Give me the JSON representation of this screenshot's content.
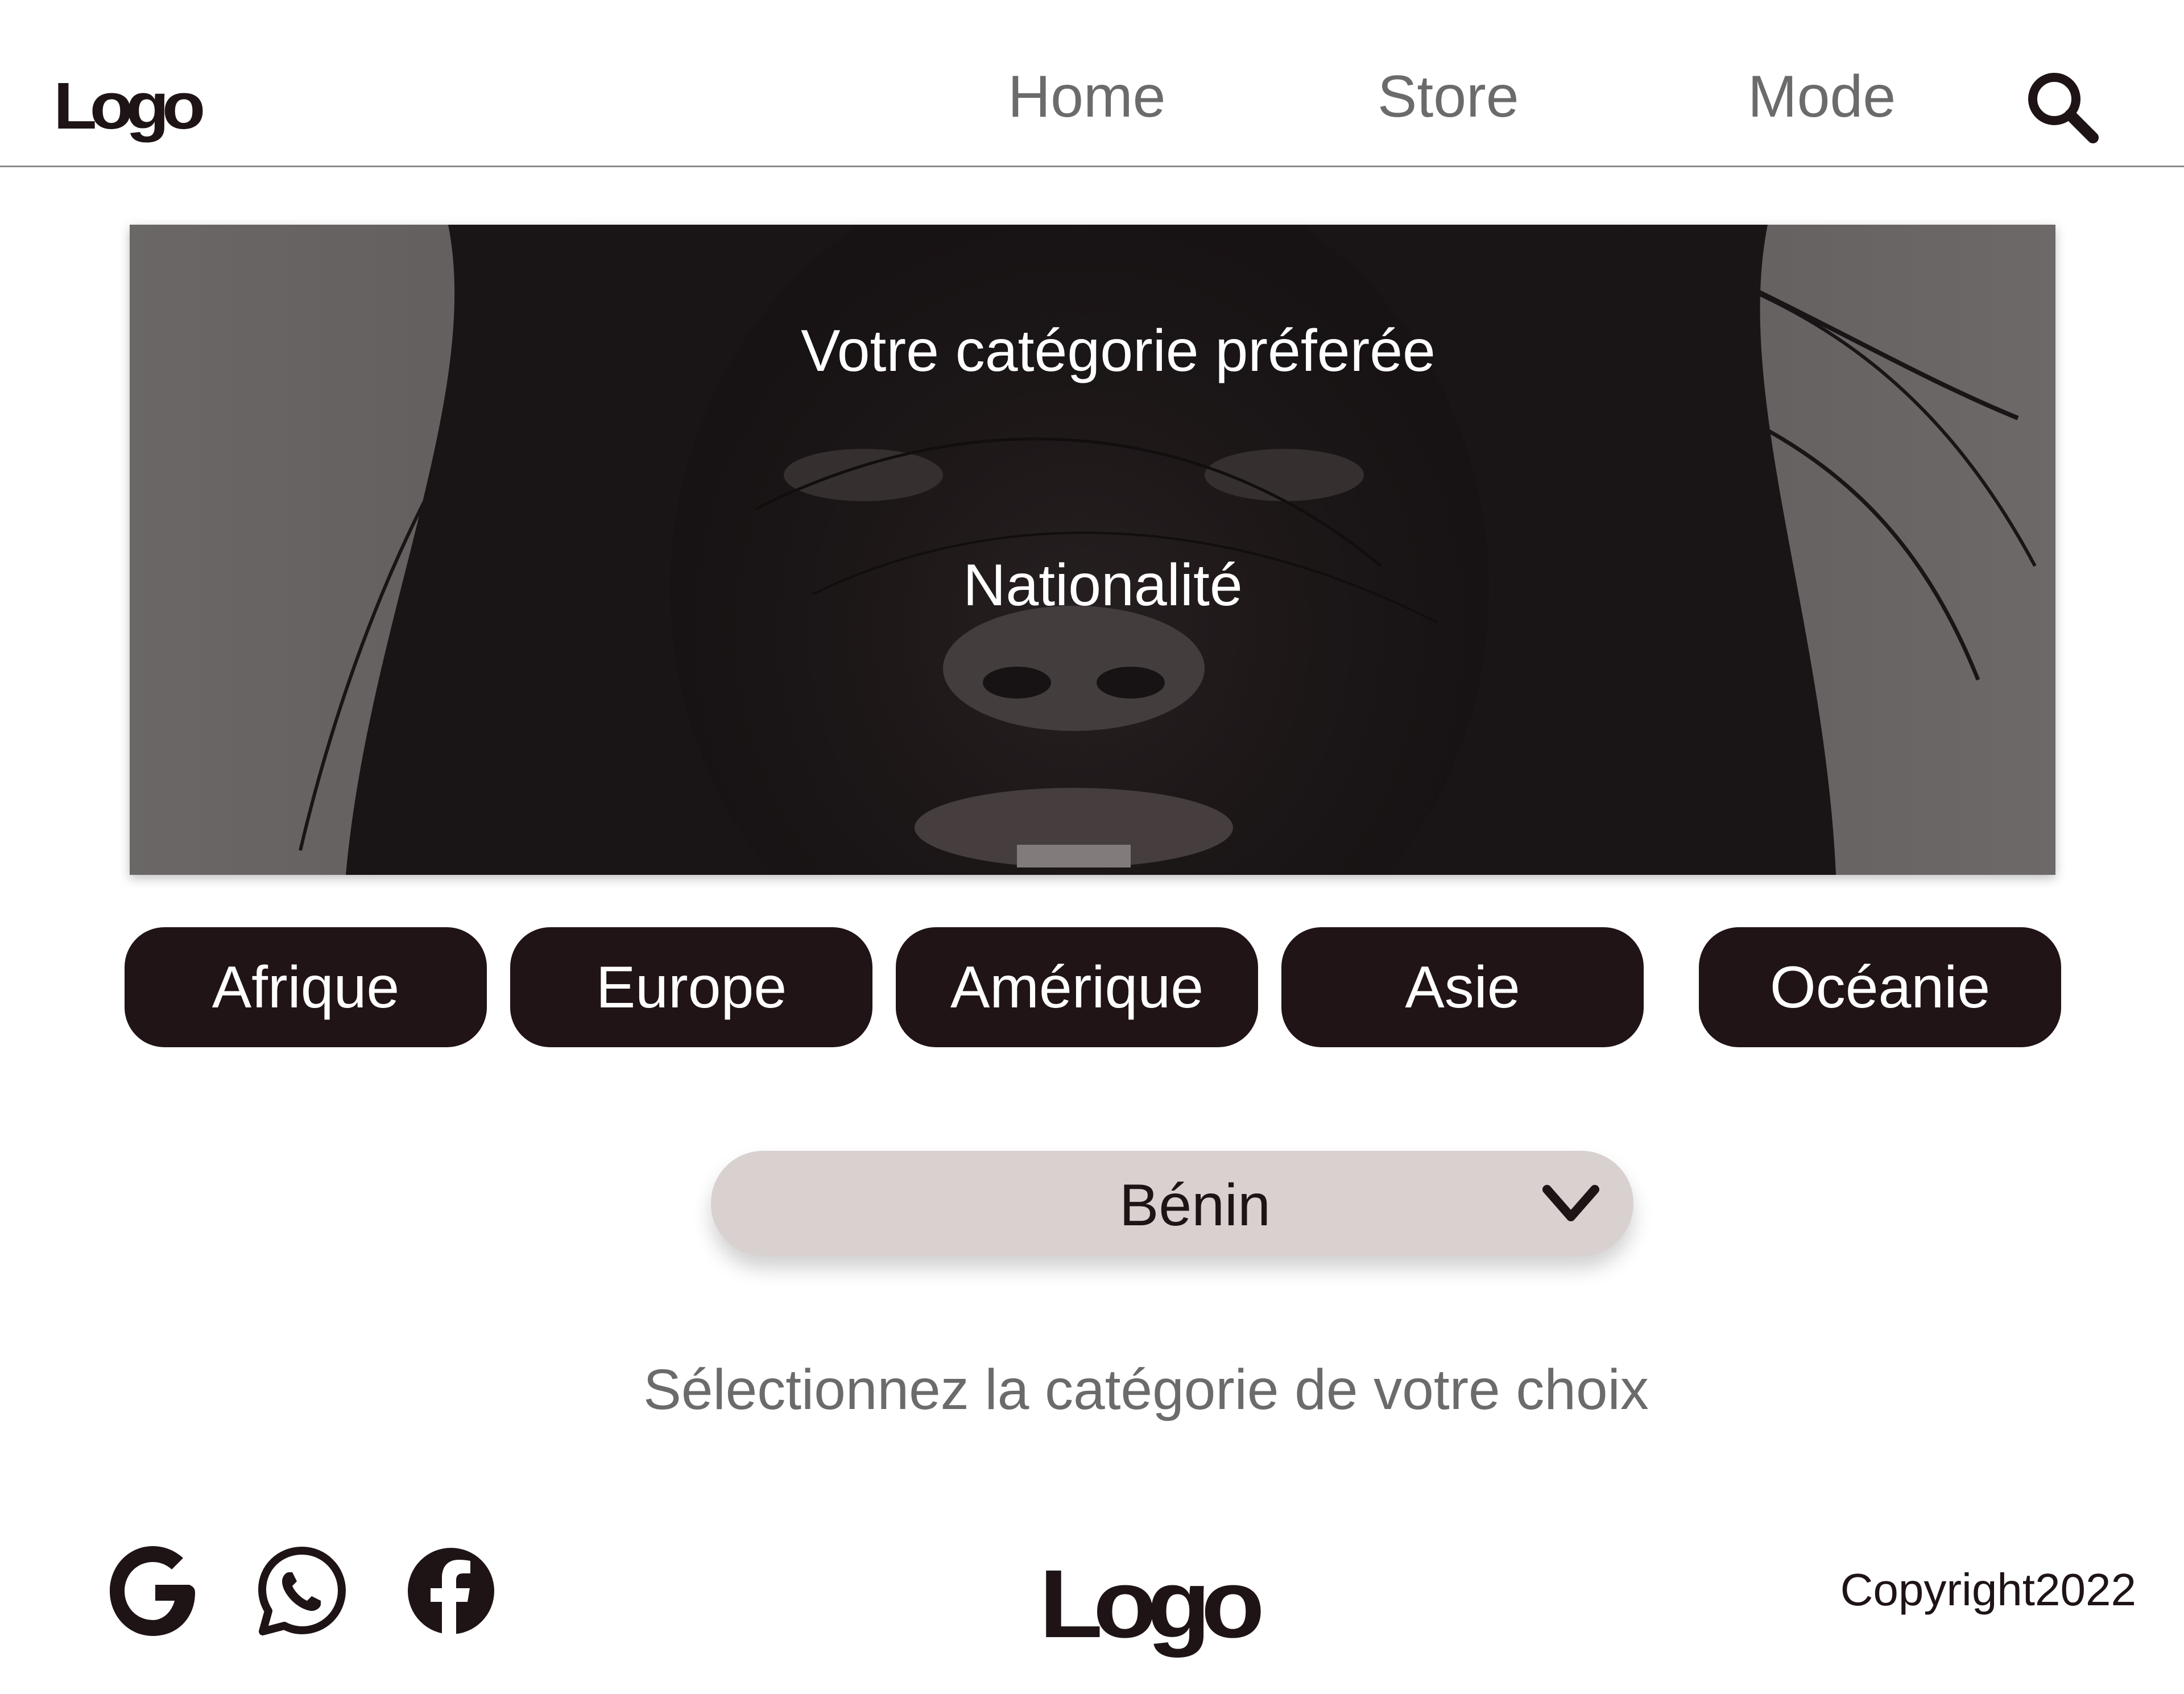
{
  "header": {
    "logo": "Logo",
    "nav": {
      "home": "Home",
      "store": "Store",
      "mode": "Mode"
    },
    "search_icon": "search-icon"
  },
  "hero": {
    "title": "Votre catégorie préferée",
    "subtitle": "Nationalité"
  },
  "regions": [
    "Afrique",
    "Europe",
    "Amérique",
    "Asie",
    "Océanie"
  ],
  "dropdown": {
    "selected": "Bénin",
    "icon": "chevron-down-icon"
  },
  "helper_text": "Sélectionnez la catégorie de votre choix",
  "footer": {
    "logo": "Logo",
    "copyright": "Copyright2022",
    "social_icons": [
      "google-icon",
      "whatsapp-icon",
      "facebook-icon"
    ]
  },
  "colors": {
    "primary_dark": "#211416",
    "dropdown_bg": "#d8d1d0",
    "nav_text": "#6b6b6b",
    "background": "#ffffff"
  }
}
